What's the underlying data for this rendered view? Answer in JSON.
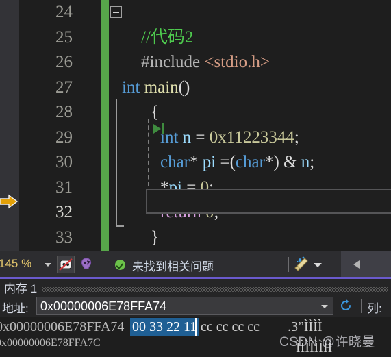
{
  "editor": {
    "lines": [
      {
        "no": "24",
        "tokens": []
      },
      {
        "no": "25",
        "tokens": [
          {
            "cls": "t-comment",
            "text": "//代码2"
          }
        ]
      },
      {
        "no": "26",
        "tokens": [
          {
            "cls": "t-pp",
            "text": "#include "
          },
          {
            "cls": "t-str",
            "text": "<stdio.h>"
          }
        ]
      },
      {
        "no": "27",
        "tokens": [
          {
            "cls": "t-kw",
            "text": "int "
          },
          {
            "cls": "t-fn",
            "text": "main"
          },
          {
            "cls": "t-punct",
            "text": "()"
          }
        ]
      },
      {
        "no": "28",
        "tokens": [
          {
            "cls": "t-punct",
            "text": "{"
          }
        ]
      },
      {
        "no": "29",
        "tokens": [
          {
            "cls": "t-kw",
            "text": "int "
          },
          {
            "cls": "t-var",
            "text": "n "
          },
          {
            "cls": "t-punct",
            "text": "= "
          },
          {
            "cls": "t-num",
            "text": "0x11223344"
          },
          {
            "cls": "t-punct",
            "text": ";"
          }
        ]
      },
      {
        "no": "30",
        "tokens": [
          {
            "cls": "t-kw",
            "text": "char"
          },
          {
            "cls": "t-punct",
            "text": "* "
          },
          {
            "cls": "t-var",
            "text": "pi "
          },
          {
            "cls": "t-punct",
            "text": "=("
          },
          {
            "cls": "t-kw",
            "text": "char"
          },
          {
            "cls": "t-punct",
            "text": "*) & "
          },
          {
            "cls": "t-var",
            "text": "n"
          },
          {
            "cls": "t-punct",
            "text": ";"
          }
        ]
      },
      {
        "no": "31",
        "tokens": [
          {
            "cls": "t-punct",
            "text": "*"
          },
          {
            "cls": "t-var",
            "text": "pi "
          },
          {
            "cls": "t-punct",
            "text": "= "
          },
          {
            "cls": "t-num",
            "text": "0"
          },
          {
            "cls": "t-punct",
            "text": ";"
          }
        ]
      },
      {
        "no": "32",
        "tokens": [
          {
            "cls": "t-ctrl",
            "text": "return "
          },
          {
            "cls": "t-num",
            "text": "0"
          },
          {
            "cls": "t-punct",
            "text": ";"
          }
        ],
        "current": true
      },
      {
        "no": "33",
        "tokens": [
          {
            "cls": "t-punct",
            "text": "}"
          }
        ]
      }
    ],
    "indents": [
      0,
      28,
      28,
      0,
      42,
      56,
      56,
      56,
      56,
      42
    ],
    "change_bar_color": "#57a64a",
    "current_statement_icon": "yellow-arrow-icon",
    "run_to_cursor_icon": "green-play-icon",
    "fold_icon": "collapse-minus-icon"
  },
  "statusbar": {
    "zoom_level": "145 %",
    "zoom_caret_icon": "chevron-down-icon",
    "no_preview_icon": "disabled-preview-icon",
    "hot_reload_icon": "hot-reload-icon",
    "status_icon": "green-check-icon",
    "status_text": "未找到相关问题",
    "broom_icon": "code-cleanup-broom-icon",
    "broom_caret_icon": "chevron-down-icon",
    "collapse_icon": "left-arrow-icon"
  },
  "memory_window": {
    "tab_label": "内存 1",
    "tab_accent_color": "#6a5acd",
    "address_label": "地址:",
    "address_value": "0x00000006E78FFA74",
    "address_caret_icon": "chevron-down-icon",
    "refresh_icon": "refresh-icon",
    "columns_label": "列:",
    "rows": [
      {
        "address": "0x00000006E78FFA74",
        "hex_selected": "00 33 22 11",
        "hex_rest": "cc cc cc cc",
        "ascii": ".3”\u0011ÌÌÌÌ"
      },
      {
        "address": "0x00000006E78FFA7C",
        "hex_selected": "",
        "hex_rest": "",
        "ascii": "ÌÌÌÌÌÌÌÌ"
      }
    ]
  },
  "watermark": {
    "text": "CSDN @许晓曼"
  }
}
